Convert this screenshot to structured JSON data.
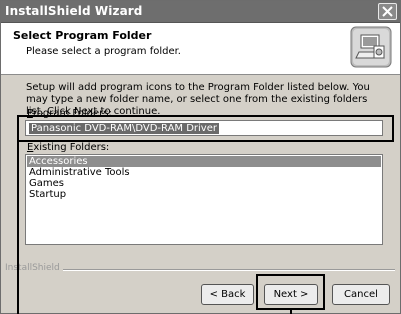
{
  "window": {
    "title": "InstallShield Wizard"
  },
  "header": {
    "title": "Select Program Folder",
    "subtitle": "Please select a program folder.",
    "icon": "installer-computer-icon"
  },
  "body": {
    "description": "Setup will add program icons to the Program Folder listed below.  You may type a new folder name, or select one from the existing folders list.  Click Next to continue.",
    "program_folders_label_accel": "P",
    "program_folders_label_rest": "rogram Folders:",
    "program_folder_value": "Panasonic DVD-RAM\\DVD-RAM Driver",
    "existing_folders_label_accel": "E",
    "existing_folders_label_rest": "xisting Folders:",
    "existing_folders": [
      {
        "label": "Accessories",
        "selected": true
      },
      {
        "label": "Administrative Tools",
        "selected": false
      },
      {
        "label": "Games",
        "selected": false
      },
      {
        "label": "Startup",
        "selected": false
      }
    ]
  },
  "footer": {
    "brand": "InstallShield",
    "back_label": "< Back",
    "next_label": "Next >",
    "cancel_label": "Cancel"
  }
}
